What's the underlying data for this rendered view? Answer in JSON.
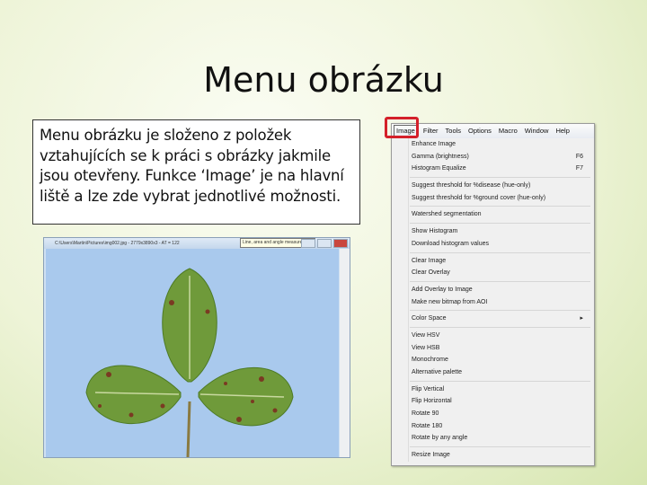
{
  "slide": {
    "title": "Menu obrázku",
    "body": "Menu obrázku je složeno z položek vztahujících se k práci s obrázky jakmile jsou otevřeny. Funkce ‘Image’ je na hlavní liště a lze zde vybrat jednotlivé možnosti."
  },
  "window": {
    "title": "C:\\Users\\Martin\\Pictures\\img002.jpg - 2779x3890x3 - AT = 122",
    "tooltip": "Line, area and angle measurement"
  },
  "menubar": [
    "Image",
    "Filter",
    "Tools",
    "Options",
    "Macro",
    "Window",
    "Help"
  ],
  "menu_groups": [
    [
      {
        "label": "Enhance Image"
      },
      {
        "label": "Gamma (brightness)",
        "shortcut": "F6"
      },
      {
        "label": "Histogram Equalize",
        "shortcut": "F7"
      }
    ],
    [
      {
        "label": "Suggest threshold for %disease (hue-only)"
      },
      {
        "label": "Suggest threshold for %ground cover (hue-only)"
      }
    ],
    [
      {
        "label": "Watershed segmentation"
      }
    ],
    [
      {
        "label": "Show Histogram"
      },
      {
        "label": "Download histogram values"
      }
    ],
    [
      {
        "label": "Clear Image"
      },
      {
        "label": "Clear Overlay"
      }
    ],
    [
      {
        "label": "Add Overlay to Image"
      },
      {
        "label": "Make new bitmap from AOI"
      }
    ],
    [
      {
        "label": "Color Space",
        "submenu": "▸"
      }
    ],
    [
      {
        "label": "View HSV"
      },
      {
        "label": "View HSB"
      },
      {
        "label": "Monochrome"
      },
      {
        "label": "Alternative palette"
      }
    ],
    [
      {
        "label": "Flip Vertical"
      },
      {
        "label": "Flip Horizontal"
      },
      {
        "label": "Rotate 90"
      },
      {
        "label": "Rotate 180"
      },
      {
        "label": "Rotate by any angle"
      }
    ],
    [
      {
        "label": "Resize Image"
      }
    ]
  ],
  "colors": {
    "highlight": "#d4202a",
    "canvas": "#a9c9ed",
    "leaf": "#6f9a3a"
  }
}
